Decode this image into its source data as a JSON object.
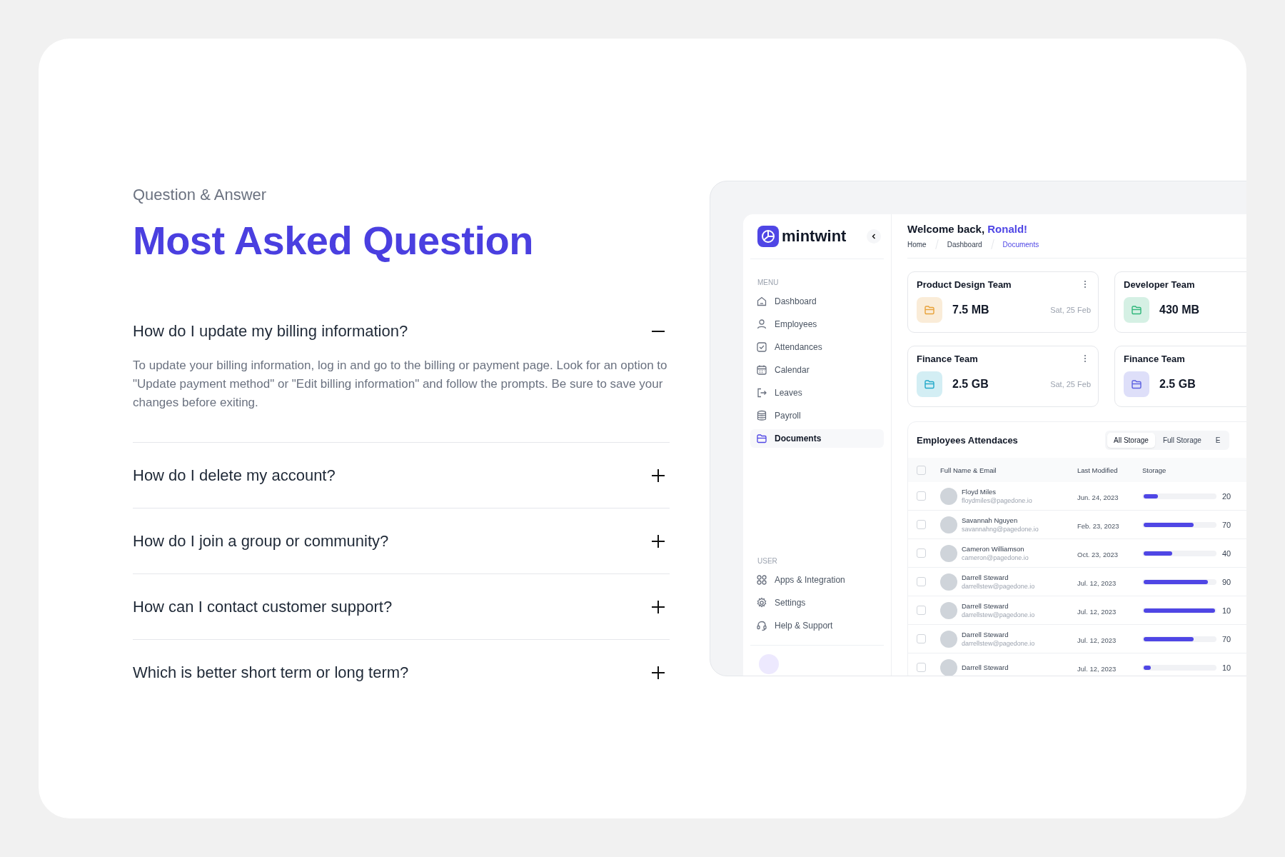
{
  "faq": {
    "eyebrow": "Question & Answer",
    "title": "Most Asked Question",
    "items": [
      {
        "question": "How do I update my billing information?",
        "expanded": true,
        "answer": "To update your billing information, log in and go to the billing or payment page. Look for an option to \"Update payment method\" or \"Edit billing information\" and follow the prompts. Be sure to save your changes before exiting."
      },
      {
        "question": "How do I delete my account?",
        "expanded": false
      },
      {
        "question": "How do I join a group or community?",
        "expanded": false
      },
      {
        "question": "How can I contact customer support?",
        "expanded": false
      },
      {
        "question": "Which is better short term or long term?",
        "expanded": false
      }
    ]
  },
  "dashboard": {
    "brand": "mintwint",
    "sidebar": {
      "sections": [
        {
          "label": "MENU",
          "items": [
            {
              "label": "Dashboard",
              "selected": false
            },
            {
              "label": "Employees",
              "selected": false
            },
            {
              "label": "Attendances",
              "selected": false
            },
            {
              "label": "Calendar",
              "selected": false
            },
            {
              "label": "Leaves",
              "selected": false
            },
            {
              "label": "Payroll",
              "selected": false
            },
            {
              "label": "Documents",
              "selected": true
            }
          ]
        },
        {
          "label": "USER",
          "items": [
            {
              "label": "Apps & Integration",
              "selected": false
            },
            {
              "label": "Settings",
              "selected": false
            },
            {
              "label": "Help & Support",
              "selected": false
            }
          ]
        }
      ]
    },
    "welcome": {
      "greeting": "Welcome back,",
      "name": "Ronald!"
    },
    "breadcrumbs": [
      {
        "label": "Home",
        "selected": false
      },
      {
        "label": "Dashboard",
        "selected": false
      },
      {
        "label": "Documents",
        "selected": true
      }
    ],
    "cards": [
      {
        "title": "Product Design Team",
        "size": "7.5 MB",
        "date": "Sat, 25 Feb",
        "color": "#e8a23a"
      },
      {
        "title": "Developer Team",
        "size": "430 MB",
        "color": "#2fb67a"
      },
      {
        "title": "Finance Team",
        "size": "2.5 GB",
        "date": "Sat, 25 Feb",
        "color": "#22a9c9"
      },
      {
        "title": "Finance Team",
        "size": "2.5 GB",
        "color": "#5b5fe0"
      }
    ],
    "table": {
      "title": "Employees Attendaces",
      "tabs": [
        {
          "label": "All Storage",
          "selected": true
        },
        {
          "label": "Full Storage",
          "selected": false
        },
        {
          "label": "E",
          "selected": false
        }
      ],
      "select_all_checked": false,
      "columns": [
        "Full Name & Email",
        "Last Modified",
        "Storage"
      ],
      "rows": [
        {
          "name": "Floyd Miles",
          "email": "floydmiles@pagedone.io",
          "modified": "Jun. 24, 2023",
          "level": 0.2,
          "reading": "20",
          "checked": false
        },
        {
          "name": "Savannah Nguyen",
          "email": "savannahng@pagedone.io",
          "modified": "Feb. 23, 2023",
          "level": 0.7,
          "reading": "70",
          "checked": false
        },
        {
          "name": "Cameron Williamson",
          "email": "cameron@pagedone.io",
          "modified": "Oct. 23, 2023",
          "level": 0.4,
          "reading": "40",
          "checked": false
        },
        {
          "name": "Darrell Steward",
          "email": "darrellstew@pagedone.io",
          "modified": "Jul. 12, 2023",
          "level": 0.9,
          "reading": "90",
          "checked": false
        },
        {
          "name": "Darrell Steward",
          "email": "darrellstew@pagedone.io",
          "modified": "Jul. 12, 2023",
          "level": 1.0,
          "reading": "10",
          "checked": false
        },
        {
          "name": "Darrell Steward",
          "email": "darrellstew@pagedone.io",
          "modified": "Jul. 12, 2023",
          "level": 0.7,
          "reading": "70",
          "checked": false
        },
        {
          "name": "Darrell Steward",
          "modified": "Jul. 12, 2023",
          "level": 0.1,
          "reading": "10",
          "checked": false
        }
      ]
    }
  }
}
